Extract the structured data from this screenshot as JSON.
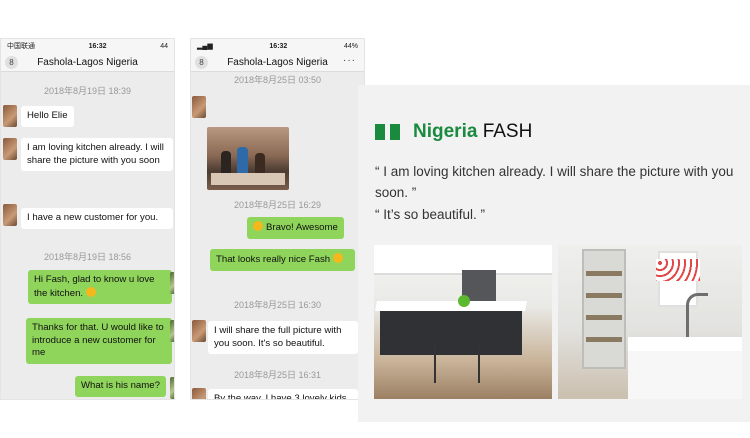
{
  "left_phone": {
    "status": {
      "carrier": "中国联通 ",
      "time": "16:32",
      "right": "44"
    },
    "nav": {
      "back_badge": "8",
      "title": "Fashola-Lagos Nigeria"
    },
    "timestamps": [
      "2018年8月19日 18:39",
      "2018年8月19日 18:56"
    ],
    "messages": [
      {
        "from": "them",
        "text": "Hello Elie"
      },
      {
        "from": "them",
        "text": "I am loving kitchen already. I will share the picture with you soon"
      },
      {
        "from": "them",
        "text": "I have a new customer for you."
      },
      {
        "from": "me",
        "text": "Hi Fash, glad to know u love the kitchen. "
      },
      {
        "from": "me",
        "text": "Thanks for that. U would like to introduce a new customer for me"
      },
      {
        "from": "me",
        "text": "What is his name?"
      }
    ]
  },
  "right_phone": {
    "status": {
      "time": "16:32",
      "right": "44%"
    },
    "nav": {
      "back_badge": "8",
      "title": "Fashola-Lagos Nigeria",
      "more": "···"
    },
    "timestamps": [
      "2018年8月25日 03:50",
      "2018年8月25日 16:29",
      "2018年8月25日 16:30",
      "2018年8月25日 16:31"
    ],
    "messages": [
      {
        "from": "me",
        "text": "Bravo! Awesome"
      },
      {
        "from": "me",
        "text": "That looks really nice Fash "
      },
      {
        "from": "them",
        "text": "I will share the full picture with you soon. It's so beautiful."
      },
      {
        "from": "them",
        "text": "By the way, I have 3 lovely kids"
      }
    ]
  },
  "card": {
    "title_country": "Nigeria",
    "title_name": " FASH",
    "quote1": "“ I am loving kitchen already. I will share the picture with you soon. ”",
    "quote2": "“ It’s so beautiful. ”",
    "accent_color": "#1a8a3f"
  }
}
